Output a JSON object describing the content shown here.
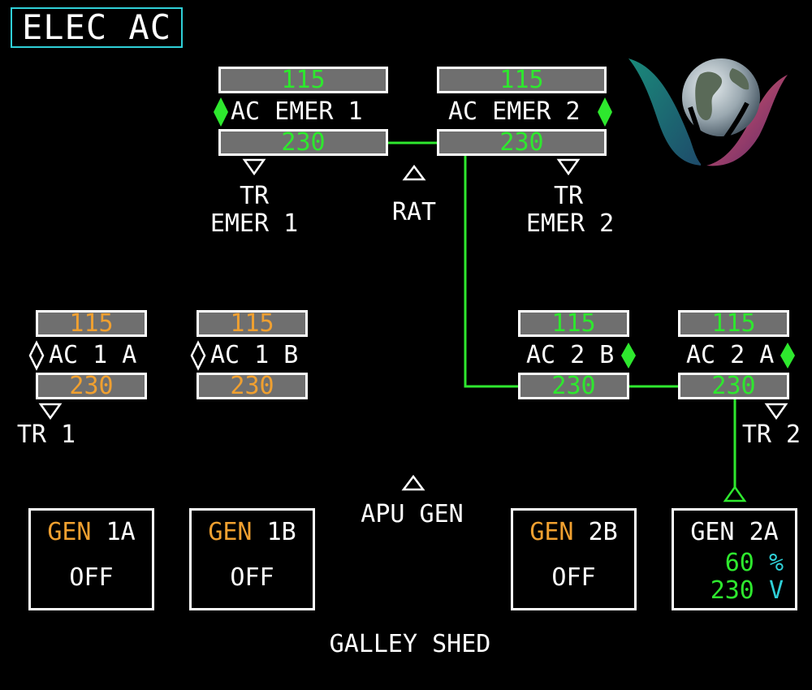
{
  "page": {
    "title": "ELEC AC"
  },
  "colors": {
    "green": "#2ee82e",
    "amber": "#f0a030",
    "cyan": "#2fd0d8",
    "bus_fill": "#6f6f6f"
  },
  "emer_buses": {
    "ac_emer_1": {
      "label": "AC EMER 1",
      "v115": "115",
      "v230": "230"
    },
    "ac_emer_2": {
      "label": "AC EMER 2",
      "v115": "115",
      "v230": "230"
    }
  },
  "tr_labels": {
    "tr_emer_1": {
      "line1": "TR",
      "line2": "EMER 1"
    },
    "tr_emer_2": {
      "line1": "TR",
      "line2": "EMER 2"
    },
    "tr_1": "TR 1",
    "tr_2": "TR 2"
  },
  "rat": {
    "label": "RAT"
  },
  "main_buses": {
    "ac_1a": {
      "label": "AC 1 A",
      "v115": "115",
      "v230": "230"
    },
    "ac_1b": {
      "label": "AC 1 B",
      "v115": "115",
      "v230": "230"
    },
    "ac_2b": {
      "label": "AC 2 B",
      "v115": "115",
      "v230": "230"
    },
    "ac_2a": {
      "label": "AC 2 A",
      "v115": "115",
      "v230": "230"
    }
  },
  "apu_gen": {
    "label": "APU GEN"
  },
  "generators": {
    "gen_1a": {
      "word": "GEN",
      "id": "1A",
      "state": "OFF"
    },
    "gen_1b": {
      "word": "GEN",
      "id": "1B",
      "state": "OFF"
    },
    "gen_2b": {
      "word": "GEN",
      "id": "2B",
      "state": "OFF"
    },
    "gen_2a": {
      "word": "GEN",
      "id": "2A",
      "load_value": "60",
      "load_unit": "%",
      "volt_value": "230",
      "volt_unit": "V"
    }
  },
  "galley": {
    "label": "GALLEY SHED"
  },
  "icons": {
    "logo": "globe-logo-icon"
  }
}
